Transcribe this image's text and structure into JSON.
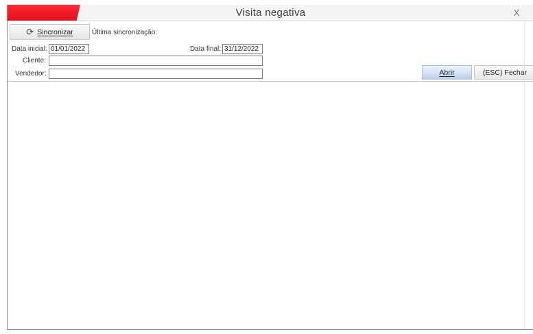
{
  "window": {
    "title": "Visita negativa",
    "close_label": "X"
  },
  "toolbar": {
    "sync_label": "Sincronizar",
    "sync_icon": "refresh-icon",
    "last_sync_label": "Última sincronização:",
    "last_sync_value": ""
  },
  "filters": {
    "start_date_label": "Data inicial:",
    "start_date_value": "01/01/2022",
    "end_date_label": "Data final:",
    "end_date_value": "31/12/2022",
    "client_label": "Cliente:",
    "client_value": "",
    "seller_label": "Vendedor:",
    "seller_value": ""
  },
  "actions": {
    "open_label": "Abrir",
    "close_label": "(ESC) Fechar"
  },
  "colors": {
    "accent": "#e8121e",
    "primary_button": "#cfdcef"
  }
}
